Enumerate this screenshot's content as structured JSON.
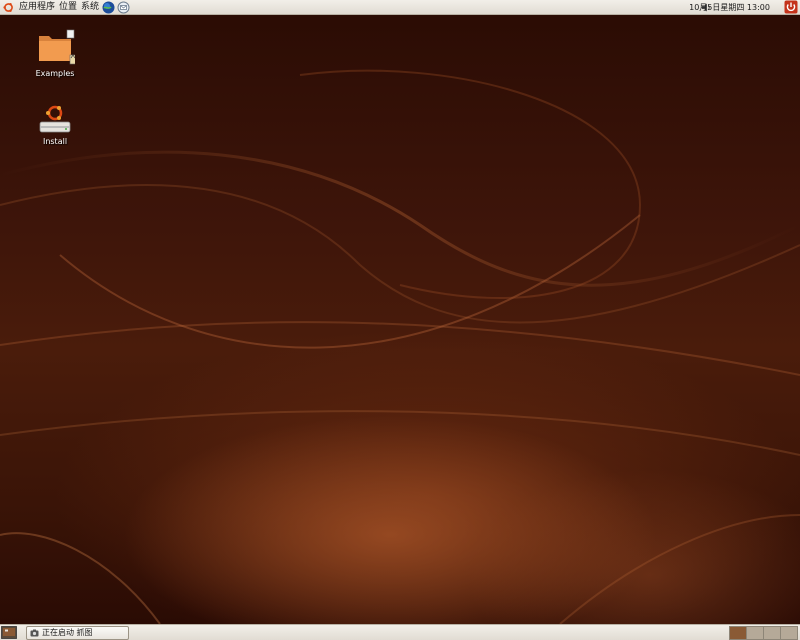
{
  "top_panel": {
    "menus": [
      {
        "label": "应用程序"
      },
      {
        "label": "位置"
      },
      {
        "label": "系统"
      }
    ],
    "launchers": [
      {
        "icon": "globe-icon"
      },
      {
        "icon": "mail-icon"
      }
    ],
    "volume_icon": "speaker-icon",
    "clock": "10月5日星期四 13:00",
    "shutdown_icon": "power-icon"
  },
  "desktop": {
    "icons": [
      {
        "label": "Examples",
        "icon": "folder-icon"
      },
      {
        "label": "Install",
        "icon": "install-icon"
      }
    ]
  },
  "bottom_panel": {
    "show_desktop_icon": "show-desktop-icon",
    "task": {
      "label": "正在启动 抓图",
      "icon": "camera-icon"
    },
    "workspaces": [
      {
        "active": true
      },
      {
        "active": false
      },
      {
        "active": false
      },
      {
        "active": false
      }
    ]
  },
  "colors": {
    "panel": "#e8e4dd",
    "wallpaper_dark": "#2b0c04",
    "wallpaper_light": "#a85a2e",
    "ubuntu_orange": "#dd4814"
  }
}
